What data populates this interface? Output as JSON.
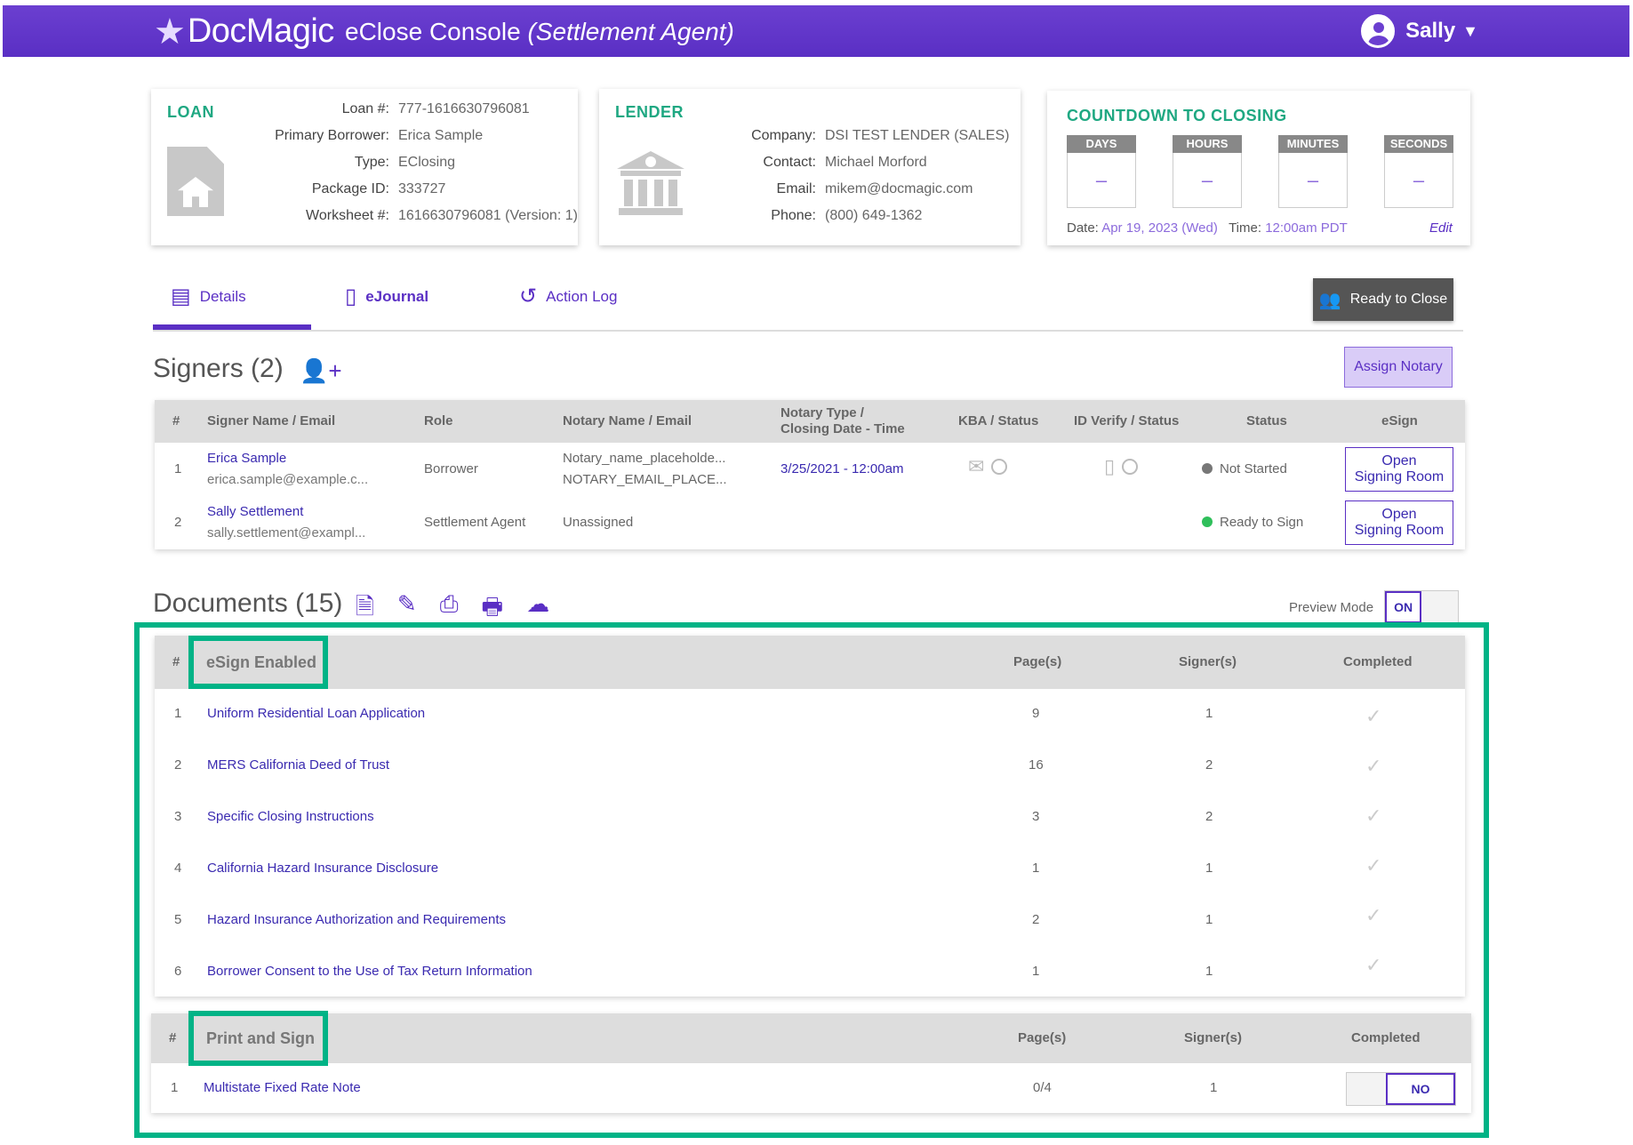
{
  "header": {
    "brand": "DocMagic",
    "app_title": "eClose Console",
    "app_role": "(Settlement Agent)",
    "user_name": "Sally"
  },
  "loan": {
    "title": "LOAN",
    "fields": [
      {
        "label": "Loan #:",
        "value": "777-1616630796081"
      },
      {
        "label": "Primary Borrower:",
        "value": "Erica Sample"
      },
      {
        "label": "Type:",
        "value": "EClosing"
      },
      {
        "label": "Package ID:",
        "value": "333727"
      },
      {
        "label": "Worksheet #:",
        "value": "1616630796081 (Version: 1)"
      }
    ]
  },
  "lender": {
    "title": "LENDER",
    "fields": [
      {
        "label": "Company:",
        "value": "DSI TEST LENDER (SALES)"
      },
      {
        "label": "Contact:",
        "value": "Michael Morford"
      },
      {
        "label": "Email:",
        "value": "mikem@docmagic.com"
      },
      {
        "label": "Phone:",
        "value": "(800) 649-1362"
      }
    ]
  },
  "countdown": {
    "title": "COUNTDOWN TO CLOSING",
    "boxes": [
      {
        "label": "DAYS",
        "value": "–"
      },
      {
        "label": "HOURS",
        "value": "–"
      },
      {
        "label": "MINUTES",
        "value": "–"
      },
      {
        "label": "SECONDS",
        "value": "–"
      }
    ],
    "date_label": "Date:",
    "date_value": "Apr 19, 2023 (Wed)",
    "time_label": "Time:",
    "time_value": "12:00am PDT",
    "edit": "Edit"
  },
  "tabs": [
    {
      "label": "Details",
      "icon": "id-card-icon"
    },
    {
      "label": "eJournal",
      "icon": "document-icon"
    },
    {
      "label": "Action Log",
      "icon": "history-icon"
    }
  ],
  "ready_to_close": "Ready to Close",
  "signers": {
    "title": "Signers (2)",
    "assign_notary": "Assign Notary",
    "columns": [
      "#",
      "Signer Name / Email",
      "Role",
      "Notary Name / Email",
      "Notary Type /",
      "Closing Date - Time",
      "KBA / Status",
      "ID Verify / Status",
      "Status",
      "eSign"
    ],
    "rows": [
      {
        "num": "1",
        "name": "Erica Sample",
        "email": "erica.sample@example.c...",
        "role": "Borrower",
        "notary_name": "Notary_name_placeholde...",
        "notary_email": "NOTARY_EMAIL_PLACE...",
        "closing": "3/25/2021 - 12:00am",
        "status": "Not Started",
        "status_color": "#777777",
        "esign_line1": "Open",
        "esign_line2": "Signing Room"
      },
      {
        "num": "2",
        "name": "Sally Settlement",
        "email": "sally.settlement@exampl...",
        "role": "Settlement Agent",
        "notary_name": "Unassigned",
        "notary_email": "",
        "closing": "",
        "status": "Ready to Sign",
        "status_color": "#2fbf5a",
        "esign_line1": "Open",
        "esign_line2": "Signing Room"
      }
    ]
  },
  "documents": {
    "title": "Documents (15)",
    "preview_label": "Preview Mode",
    "preview_state": "ON",
    "esign": {
      "group_label": "eSign Enabled",
      "col_num": "#",
      "col_pages": "Page(s)",
      "col_signers": "Signer(s)",
      "col_completed": "Completed",
      "rows": [
        {
          "num": "1",
          "name": "Uniform Residential Loan Application",
          "pages": "9",
          "signers": "1"
        },
        {
          "num": "2",
          "name": "MERS California Deed of Trust",
          "pages": "16",
          "signers": "2"
        },
        {
          "num": "3",
          "name": "Specific Closing Instructions",
          "pages": "3",
          "signers": "2"
        },
        {
          "num": "4",
          "name": "California Hazard Insurance Disclosure",
          "pages": "1",
          "signers": "1"
        },
        {
          "num": "5",
          "name": "Hazard Insurance Authorization and Requirements",
          "pages": "2",
          "signers": "1"
        },
        {
          "num": "6",
          "name": "Borrower Consent to the Use of Tax Return Information",
          "pages": "1",
          "signers": "1"
        }
      ]
    },
    "print_sign": {
      "group_label": "Print and Sign",
      "col_num": "#",
      "col_pages": "Page(s)",
      "col_signers": "Signer(s)",
      "col_completed": "Completed",
      "rows": [
        {
          "num": "1",
          "name": "Multistate Fixed Rate Note",
          "pages": "0/4",
          "signers": "1",
          "completed": "NO"
        }
      ]
    }
  }
}
